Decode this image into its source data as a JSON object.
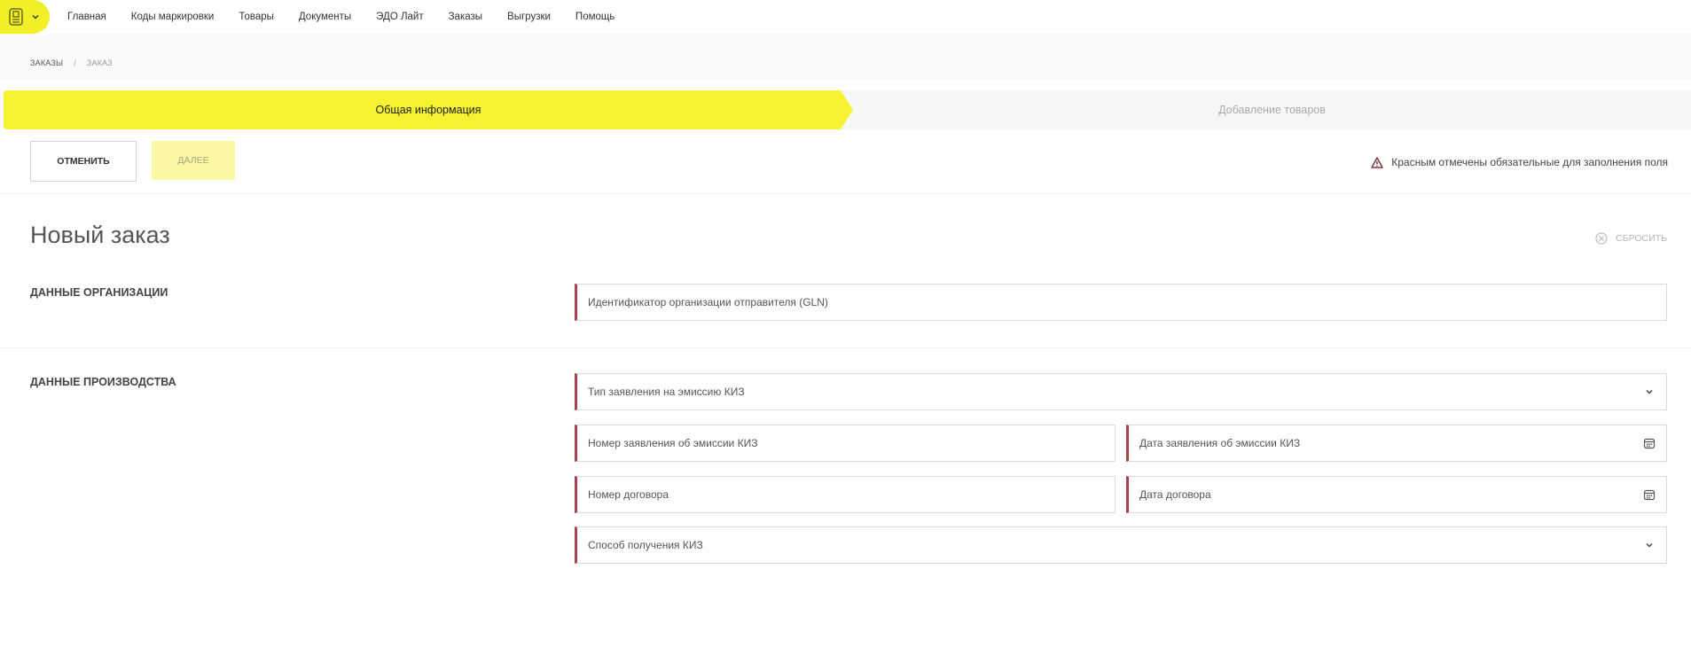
{
  "nav": {
    "items": [
      "Главная",
      "Коды маркировки",
      "Товары",
      "Документы",
      "ЭДО Лайт",
      "Заказы",
      "Выгрузки",
      "Помощь"
    ]
  },
  "breadcrumb": {
    "parent": "ЗАКАЗЫ",
    "separator": "/",
    "current": "ЗАКАЗ"
  },
  "stepper": {
    "step1": "Общая информация",
    "step2": "Добавление товаров"
  },
  "actions": {
    "cancel_label": "ОТМЕНИТЬ",
    "next_label": "ДАЛЕЕ",
    "required_note": "Красным отмечены обязательные для заполнения поля"
  },
  "page": {
    "title": "Новый заказ",
    "reset_label": "СБРОСИТЬ"
  },
  "sections": {
    "org": {
      "label": "ДАННЫЕ ОРГАНИЗАЦИИ",
      "gln_placeholder": "Идентификатор организации отправителя (GLN)"
    },
    "production": {
      "label": "ДАННЫЕ ПРОИЗВОДСТВА",
      "emission_type_placeholder": "Тип заявления на эмиссию КИЗ",
      "emission_number_placeholder": "Номер заявления об эмиссии КИЗ",
      "emission_date_placeholder": "Дата заявления об эмиссии КИЗ",
      "contract_number_placeholder": "Номер договора",
      "contract_date_placeholder": "Дата договора",
      "receive_method_placeholder": "Способ получения КИЗ"
    }
  },
  "colors": {
    "accent_yellow": "#f5f231",
    "required_border": "#a5424c"
  }
}
